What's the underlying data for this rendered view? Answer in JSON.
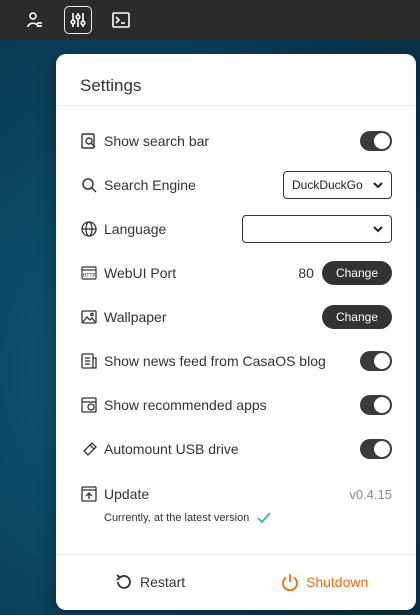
{
  "topbar": {
    "buttons": [
      {
        "name": "user-icon"
      },
      {
        "name": "settings-sliders-icon"
      },
      {
        "name": "terminal-icon"
      }
    ]
  },
  "settings": {
    "title": "Settings",
    "search_bar_label": "Show search bar",
    "search_engine_label": "Search Engine",
    "search_engine_value": "DuckDuckGo",
    "language_label": "Language",
    "language_value": "",
    "webui_port_label": "WebUI Port",
    "webui_port_value": "80",
    "change_label": "Change",
    "wallpaper_label": "Wallpaper",
    "news_feed_label": "Show news feed from CasaOS blog",
    "recommended_apps_label": "Show recommended apps",
    "automount_label": "Automount USB drive",
    "update_label": "Update",
    "version": "v0.4.15",
    "update_status": "Currently, at the latest version",
    "restart_label": "Restart",
    "shutdown_label": "Shutdown"
  },
  "colors": {
    "accent_orange": "#f06d1a",
    "check_green": "#2ec27e",
    "toggle_on": "#3a3a3a"
  }
}
